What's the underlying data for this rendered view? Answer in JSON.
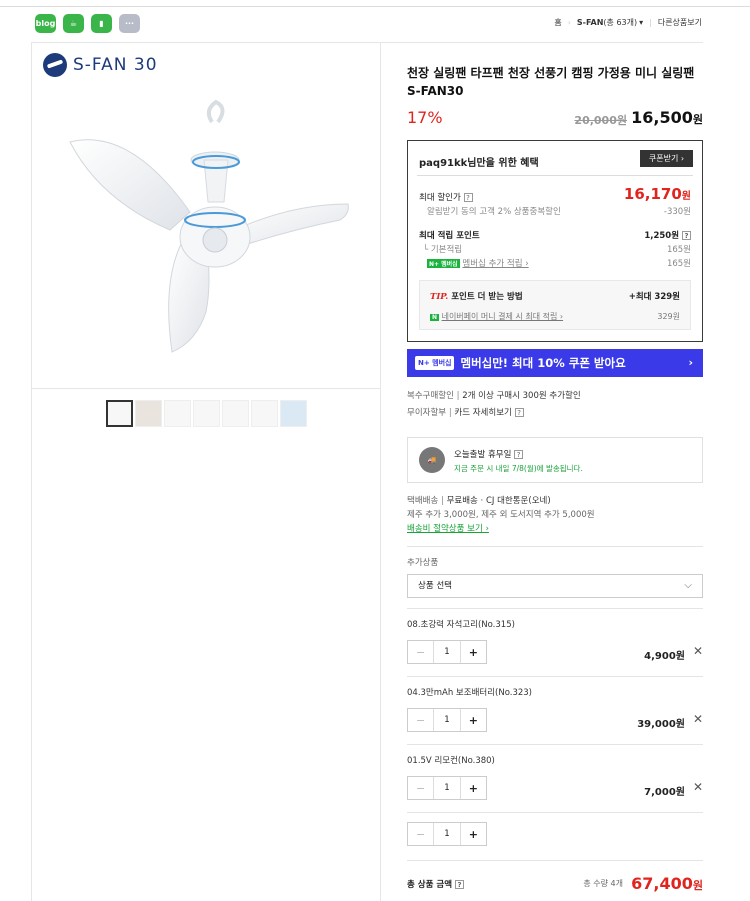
{
  "share": [
    {
      "icon": "blog-icon",
      "label": "blog",
      "color": "#3ab54a"
    },
    {
      "icon": "cafe-icon",
      "label": "☕",
      "color": "#3ab54a"
    },
    {
      "icon": "bookmark-icon",
      "label": "▮",
      "color": "#3ab54a"
    },
    {
      "icon": "more-icon",
      "label": "···",
      "color": "#b8bcc8"
    }
  ],
  "breadcrumb": {
    "home": "홈",
    "store": "S-FAN",
    "store_count": "(총 63개)",
    "more": "다른상품보기"
  },
  "logo": {
    "text": "S-FAN 30"
  },
  "product": {
    "title": "천장 실링팬 타프팬 천장 선풍기 캠핑 가정용 미니 실링팬 S-FAN30",
    "discount_rate": "17%",
    "original_price": "20,000원",
    "sale_price": "16,500",
    "won": "원"
  },
  "benefit": {
    "header": "paq91kk님만을 위한 혜택",
    "coupon_button": "쿠폰받기 ›",
    "max_discount_label": "최대 할인가",
    "max_discount_value": "16,170",
    "max_discount_unit": "원",
    "discount_note": "알림받기 동의 고객 2% 상품중복할인",
    "discount_note_value": "-330원",
    "points_label": "최대 적립 포인트",
    "points_value": "1,250원",
    "basic_points_label": "└ 기본적립",
    "basic_points_value": "165원",
    "member_points_label": "멤버십 추가 적립 ›",
    "member_points_value": "165원",
    "tip_title": "포인트 더 받는 방법",
    "tip_brand": "TIP.",
    "tip_value": "+최대 329원",
    "tip_line": "네이버페이 머니 결제 시 최대 적립 ›",
    "tip_line_value": "329원"
  },
  "membership_banner": {
    "badge": "N+ 멤버십",
    "text": "멤버십만! 최대 10% 쿠폰 받아요",
    "arrow": "›"
  },
  "extra": {
    "multi_discount_label": "복수구매할인",
    "multi_discount_value": "2개 이상 구매시 300원 추가할인",
    "installment_label": "무이자할부",
    "installment_value": "카드 자세히보기"
  },
  "delivery": {
    "title": "오늘출발 휴무일",
    "note": "지금 주문 시 내일 7/8(월)에 발송됩니다.",
    "method_label": "택배배송",
    "method_value": "무료배송 · CJ 대한통운(오네)",
    "extra_fee": "제주 추가 3,000원, 제주 외 도서지역 추가 5,000원",
    "save_link": "배송비 절약상품 보기 ›"
  },
  "additional": {
    "label": "추가상품",
    "select_placeholder": "상품 선택"
  },
  "options": [
    {
      "name": "08.초강력 자석고리(No.315)",
      "qty": "1",
      "price": "4,900원"
    },
    {
      "name": "04.3만mAh 보조배터리(No.323)",
      "qty": "1",
      "price": "39,000원"
    },
    {
      "name": "01.5V 리모컨(No.380)",
      "qty": "1",
      "price": "7,000원"
    }
  ],
  "main_qty": "1",
  "total": {
    "label": "총 상품 금액",
    "count": "총 수량 4개",
    "price": "67,400",
    "unit": "원"
  }
}
